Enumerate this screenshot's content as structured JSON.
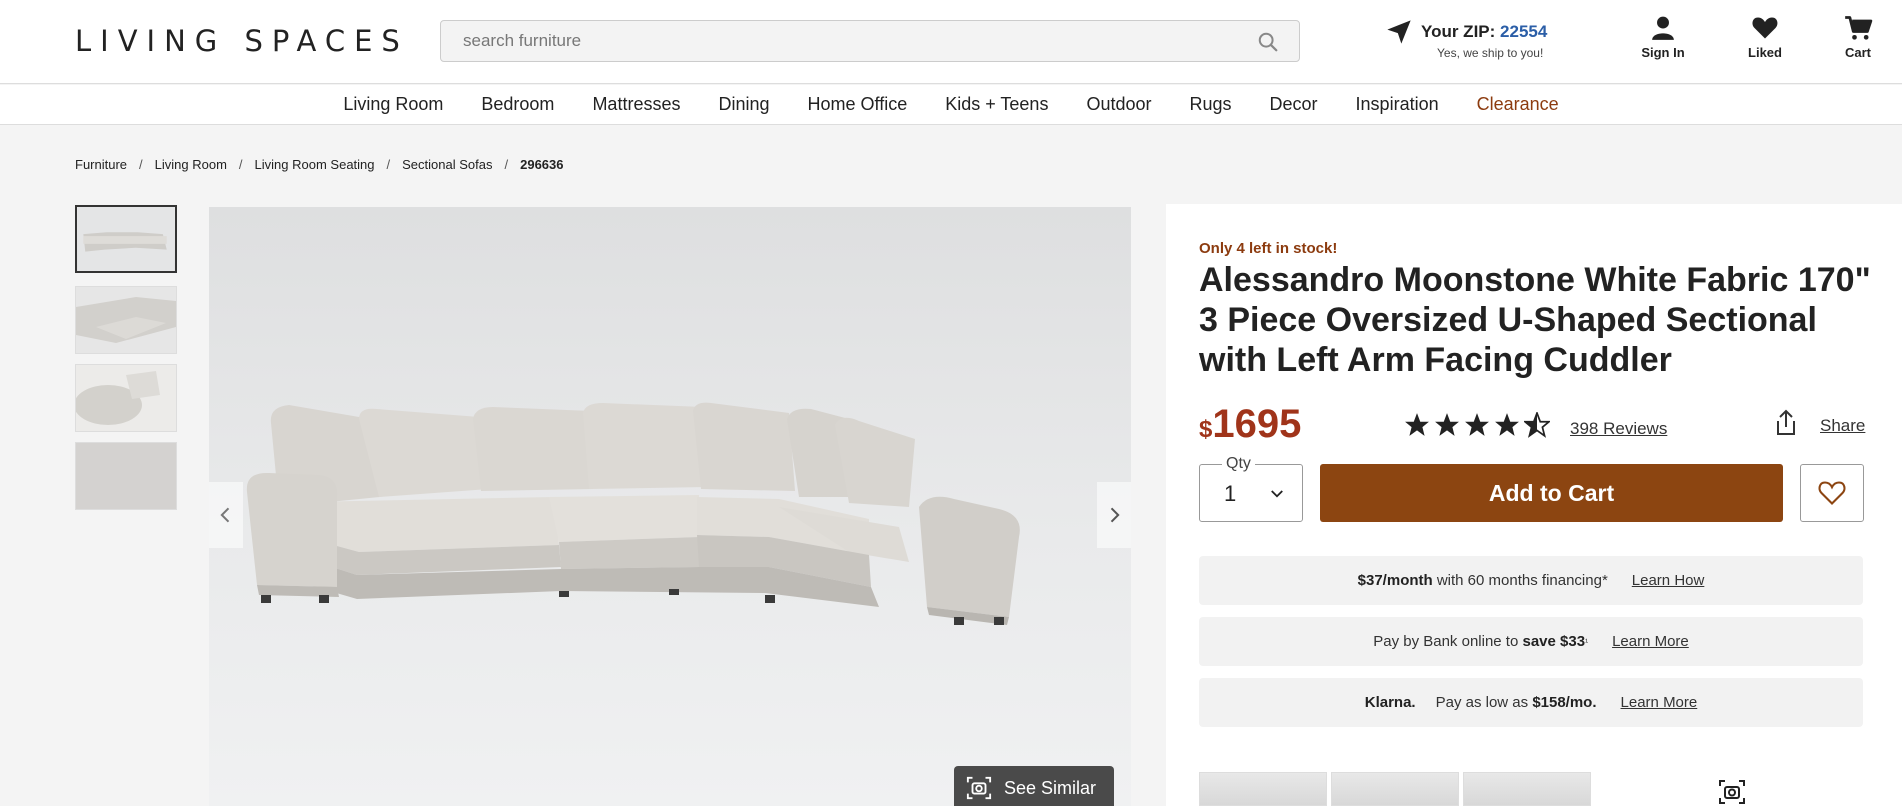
{
  "header": {
    "logo": "LIVING SPACES",
    "search_placeholder": "search furniture",
    "zip_label": "Your ZIP:",
    "zip_value": "22554",
    "zip_sub": "Yes, we ship to you!",
    "signin_label": "Sign In",
    "liked_label": "Liked",
    "cart_label": "Cart"
  },
  "nav": {
    "items": [
      "Living Room",
      "Bedroom",
      "Mattresses",
      "Dining",
      "Home Office",
      "Kids + Teens",
      "Outdoor",
      "Rugs",
      "Decor",
      "Inspiration",
      "Clearance"
    ]
  },
  "breadcrumb": {
    "items": [
      "Furniture",
      "Living Room",
      "Living Room Seating",
      "Sectional Sofas"
    ],
    "current": "296636",
    "separator": "/"
  },
  "gallery": {
    "see_similar_label": "See Similar"
  },
  "product": {
    "stock_notice": "Only 4 left in stock!",
    "title": "Alessandro Moonstone White Fabric 170\" 3 Piece Oversized U-Shaped Sectional with Left Arm Facing Cuddler",
    "currency": "$",
    "price": "1695",
    "rating": 4.5,
    "reviews_label": "398 Reviews",
    "share_label": "Share",
    "qty_label": "Qty",
    "qty_value": "1",
    "add_to_cart_label": "Add to Cart"
  },
  "financing": {
    "monthly_bold": "$37/month",
    "monthly_text": "with 60 months financing*",
    "monthly_link": "Learn How",
    "bank_text": "Pay by Bank online to",
    "bank_bold": "save $33",
    "bank_sup": "¹",
    "bank_link": "Learn More",
    "klarna_logo": "Klarna.",
    "klarna_text": "Pay as low as",
    "klarna_bold": "$158/mo.",
    "klarna_link": "Learn More"
  },
  "colors": {
    "brand_brown": "#8c4511",
    "price_red": "#a0341a",
    "clearance": "#8c3b0f",
    "zip_blue": "#2b5ea7"
  }
}
